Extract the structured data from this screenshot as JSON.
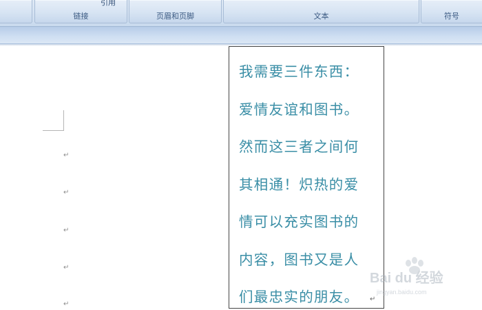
{
  "ribbon": {
    "groups": [
      {
        "label": "",
        "top_text": ""
      },
      {
        "label": "链接",
        "top_text": "引用"
      },
      {
        "label": "页眉和页脚",
        "top_text": ""
      },
      {
        "label": "文本",
        "top_text": ""
      },
      {
        "label": "符号",
        "top_text": ""
      }
    ]
  },
  "document": {
    "paragraph_mark": "↵"
  },
  "textbox": {
    "lines": [
      "我需要三件东西：",
      "爱情友谊和图书。",
      "然而这三者之间何",
      "其相通！炽热的爱",
      "情可以充实图书的",
      "内容，图书又是人",
      "们最忠实的朋友。"
    ],
    "end_mark": "↵"
  },
  "watermark": {
    "logo_text": "Bai du 经验",
    "url": "jingyan.baidu.com"
  },
  "colors": {
    "text_accent": "#3a8ea6",
    "ribbon_label": "#3b5a82"
  }
}
